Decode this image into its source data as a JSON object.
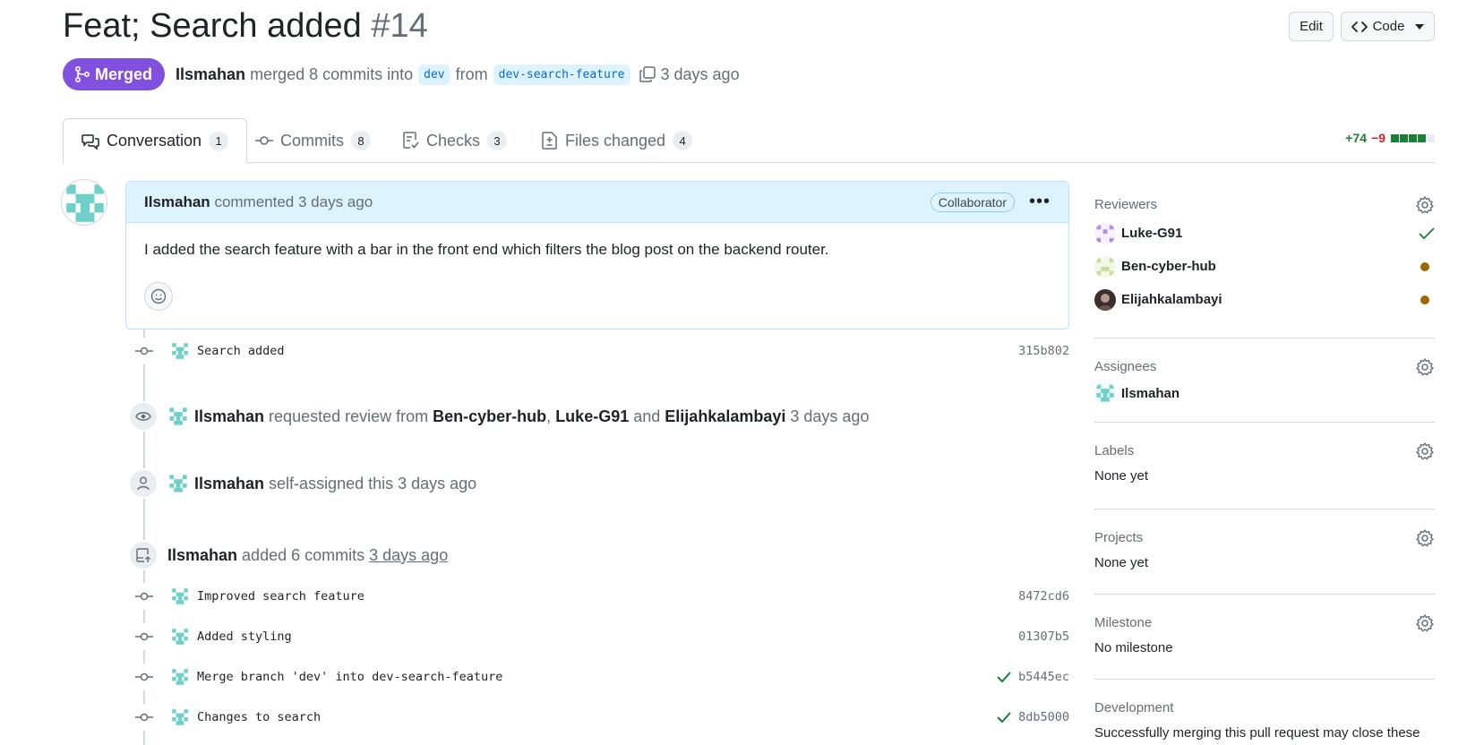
{
  "header": {
    "title": "Feat; Search added",
    "number": "#14",
    "edit_label": "Edit",
    "code_label": "Code"
  },
  "meta": {
    "status": "Merged",
    "author": "Ilsmahan",
    "action": "merged 8 commits into",
    "base_branch": "dev",
    "from_word": "from",
    "head_branch": "dev-search-feature",
    "time": "3 days ago"
  },
  "tabs": [
    {
      "label": "Conversation",
      "count": "1",
      "icon": "comment-discussion-icon"
    },
    {
      "label": "Commits",
      "count": "8",
      "icon": "git-commit-icon"
    },
    {
      "label": "Checks",
      "count": "3",
      "icon": "checklist-icon"
    },
    {
      "label": "Files changed",
      "count": "4",
      "icon": "file-diff-icon"
    }
  ],
  "diffstat": {
    "additions": "+74",
    "deletions": "−9",
    "add_color": "#1a7f37",
    "neutral_color": "#eaeef2"
  },
  "comment": {
    "author": "Ilsmahan",
    "action": "commented 3 days ago",
    "badge": "Collaborator",
    "body": "I added the search feature with a bar in the front end which filters the blog post on the backend router."
  },
  "first_commit": {
    "message": "Search added",
    "sha": "315b802"
  },
  "events": {
    "review": {
      "actor": "Ilsmahan",
      "text": "requested review from",
      "r1": "Ben-cyber-hub",
      "sep": ",",
      "r2": "Luke-G91",
      "and": "and",
      "r3": "Elijahkalambayi",
      "time": "3 days ago"
    },
    "assign": {
      "actor": "Ilsmahan",
      "text": "self-assigned this 3 days ago"
    },
    "push": {
      "actor": "Ilsmahan",
      "text": "added 6 commits",
      "time": "3 days ago"
    }
  },
  "commits": [
    {
      "message": "Improved search feature",
      "sha": "8472cd6",
      "check": false
    },
    {
      "message": "Added styling",
      "sha": "01307b5",
      "check": false
    },
    {
      "message": "Merge branch 'dev' into dev-search-feature",
      "sha": "b5445ec",
      "check": true
    },
    {
      "message": "Changes to search",
      "sha": "8db5000",
      "check": true
    }
  ],
  "sidebar": {
    "reviewers_title": "Reviewers",
    "reviewers": [
      {
        "name": "Luke-G91",
        "status": "approved"
      },
      {
        "name": "Ben-cyber-hub",
        "status": "pending"
      },
      {
        "name": "Elijahkalambayi",
        "status": "pending"
      }
    ],
    "assignees_title": "Assignees",
    "assignee": "Ilsmahan",
    "labels_title": "Labels",
    "labels_value": "None yet",
    "projects_title": "Projects",
    "projects_value": "None yet",
    "milestone_title": "Milestone",
    "milestone_value": "No milestone",
    "development_title": "Development",
    "development_value": "Successfully merging this pull request may close these"
  }
}
